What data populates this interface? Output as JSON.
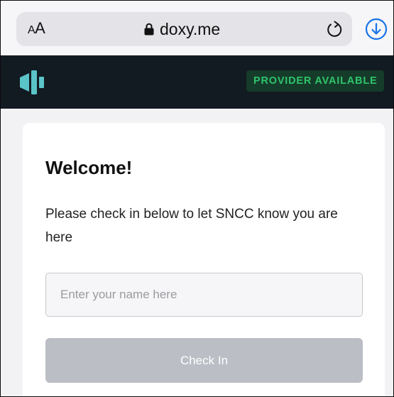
{
  "browser": {
    "text_size_label_small": "A",
    "text_size_label_large": "A",
    "url": "doxy.me",
    "icons": {
      "lock": "lock-icon",
      "reload": "reload-icon",
      "download": "download-icon"
    }
  },
  "header": {
    "logo": "doxy-logo-icon",
    "status": "PROVIDER AVAILABLE"
  },
  "checkin": {
    "title": "Welcome!",
    "subtitle": "Please check in below to let SNCC know you are here",
    "name_placeholder": "Enter your name here",
    "name_value": "",
    "button_label": "Check In"
  },
  "colors": {
    "header_bg": "#121a22",
    "brand_teal": "#5bc4c8",
    "status_green": "#2fc46c",
    "button_disabled": "#bcbec5",
    "ios_blue": "#1a73e8"
  }
}
